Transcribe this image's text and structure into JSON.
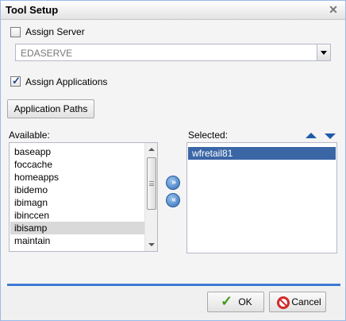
{
  "window": {
    "title": "Tool Setup",
    "close_glyph": "✕"
  },
  "assign_server": {
    "label": "Assign Server",
    "checked": false
  },
  "server_combo": {
    "value": "EDASERVE"
  },
  "assign_applications": {
    "label": "Assign Applications",
    "checked": true
  },
  "application_paths_button": {
    "label": "Application Paths"
  },
  "available": {
    "label": "Available:",
    "items": [
      "baseapp",
      "foccache",
      "homeapps",
      "ibidemo",
      "ibimagn",
      "ibinccen",
      "ibisamp",
      "maintain",
      "..."
    ],
    "selected_item": "ibisamp"
  },
  "selected": {
    "label": "Selected:",
    "items": [
      "wfretail81"
    ],
    "selected_item": "wfretail81"
  },
  "transfer": {
    "add_glyph": "»",
    "remove_glyph": "«"
  },
  "footer": {
    "ok_label": "OK",
    "cancel_label": "Cancel"
  },
  "colors": {
    "accent": "#3b66a6",
    "footer_line": "#3f7bd4",
    "ok_icon": "#3c9a1a",
    "cancel_icon": "#d12b2b"
  },
  "icons": [
    "close-icon",
    "chevron-down-icon",
    "move-right-icon",
    "move-left-icon",
    "move-up-icon",
    "move-down-icon",
    "check-icon",
    "cancel-icon"
  ]
}
